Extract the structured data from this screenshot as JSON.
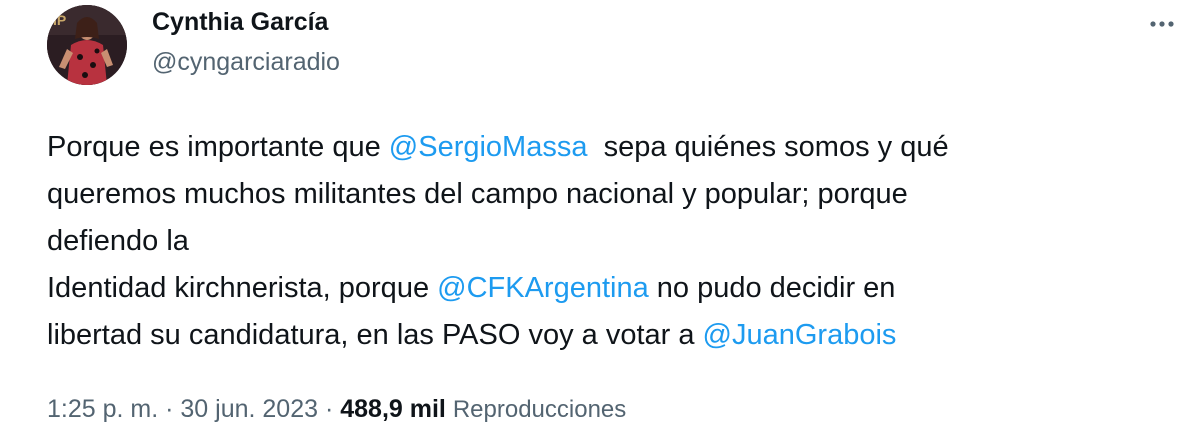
{
  "author": {
    "name": "Cynthia García",
    "handle": "@cyngarciaradio",
    "avatar_icon": "profile-photo"
  },
  "more_icon": "more-horizontal-icon",
  "tweet": {
    "line1": {
      "before": "Porque es importante que ",
      "mention": "@SergioMassa",
      "after": "  sepa quiénes somos y qué"
    },
    "line2": "queremos muchos militantes del campo nacional y popular; porque",
    "line3": "defiendo la",
    "line4": {
      "before": "Identidad kirchnerista, porque ",
      "mention": "@CFKArgentina",
      "after": " no pudo decidir en"
    },
    "line5": {
      "before": "libertad su candidatura, en las PASO voy a votar a ",
      "mention": "@JuanGrabois"
    }
  },
  "meta": {
    "time": "1:25 p. m.",
    "separator": " · ",
    "date": "30 jun. 2023",
    "views_count": "488,9 mil",
    "views_label": "Reproducciones"
  },
  "colors": {
    "text": "#0f1419",
    "secondary": "#536471",
    "link": "#1d9bf0",
    "background": "#ffffff"
  }
}
